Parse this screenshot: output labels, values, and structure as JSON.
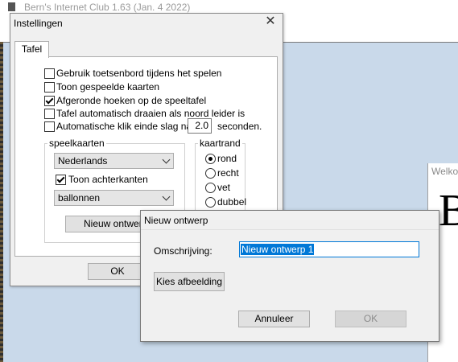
{
  "main_window": {
    "title": "Bern's Internet Club 1.63 (Jan. 4 2022)",
    "welcome_title": "Welko",
    "welcome_glyph": "B"
  },
  "settings_dialog": {
    "title": "Instellingen",
    "tab": "Tafel",
    "options": [
      {
        "label": "Gebruik toetsenbord tijdens het spelen",
        "checked": false
      },
      {
        "label": "Toon gespeelde kaarten",
        "checked": false
      },
      {
        "label": "Afgeronde hoeken op de speeltafel",
        "checked": true
      },
      {
        "label": "Tafel automatisch draaien als noord leider is",
        "checked": false
      },
      {
        "label": "Automatische klik einde slag na",
        "checked": false
      }
    ],
    "seconds_value": "2.0",
    "seconds_unit": "seconden.",
    "speelkaarten": {
      "title": "speelkaarten",
      "language": "Nederlands",
      "show_backs_label": "Toon achterkanten",
      "show_backs_checked": true,
      "back_design": "ballonnen",
      "new_design_button": "Nieuw ontwerp"
    },
    "kaartrand": {
      "title": "kaartrand",
      "options": [
        {
          "label": "rond",
          "selected": true
        },
        {
          "label": "recht",
          "selected": false
        },
        {
          "label": "vet",
          "selected": false
        },
        {
          "label": "dubbel",
          "selected": false
        }
      ]
    },
    "ok_button": "OK"
  },
  "new_design_dialog": {
    "title": "Nieuw ontwerp",
    "description_label": "Omschrijving:",
    "description_value": "Nieuw ontwerp 1",
    "choose_image_button": "Kies afbeelding",
    "cancel_button": "Annuleer",
    "ok_button": "OK",
    "ok_enabled": false
  },
  "colors": {
    "desktop": "#c9d9ea",
    "dialog": "#f0f0f0",
    "selection": "#0078d7"
  }
}
